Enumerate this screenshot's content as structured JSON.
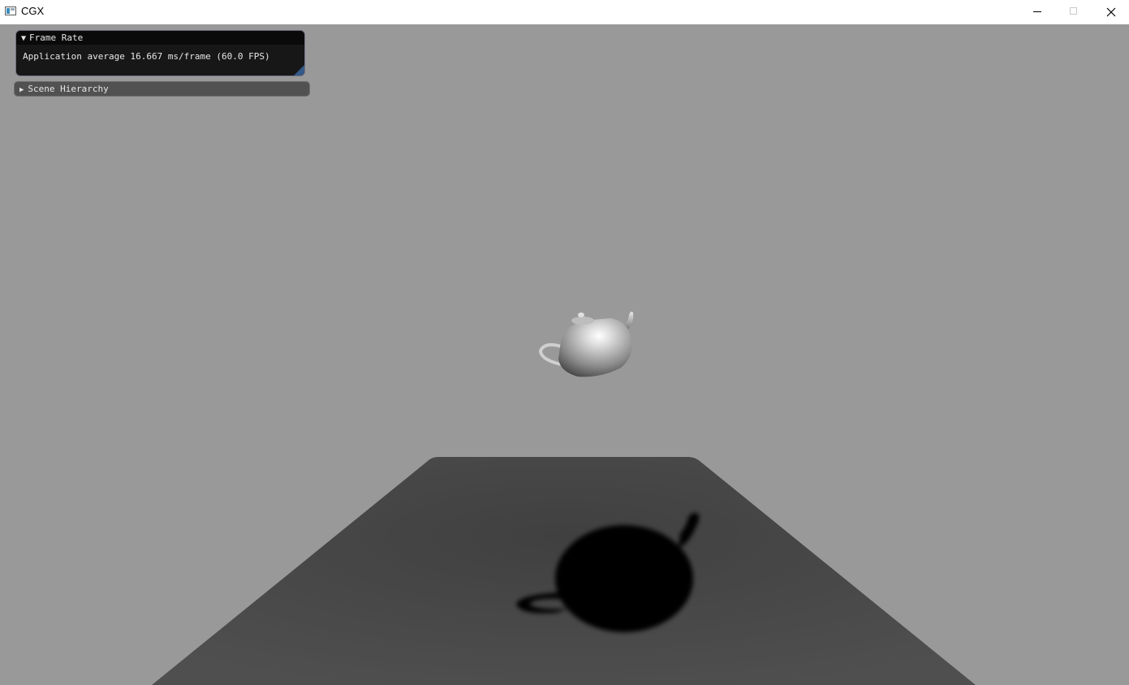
{
  "window": {
    "title": "CGX",
    "icon": "application-window-icon",
    "controls": [
      "minimize-icon",
      "maximize-icon",
      "close-icon"
    ]
  },
  "panels": {
    "frame_rate": {
      "arrow": "▼",
      "title": "Frame Rate",
      "text": "Application average 16.667 ms/frame (60.0 FPS)",
      "expanded": true
    },
    "scene_hierarchy": {
      "arrow": "▶",
      "title": "Scene Hierarchy",
      "expanded": false
    }
  },
  "scene": {
    "background_color": "#999999",
    "floor_color": "#474747",
    "shadow_color": "#000000",
    "object": "teapot"
  }
}
